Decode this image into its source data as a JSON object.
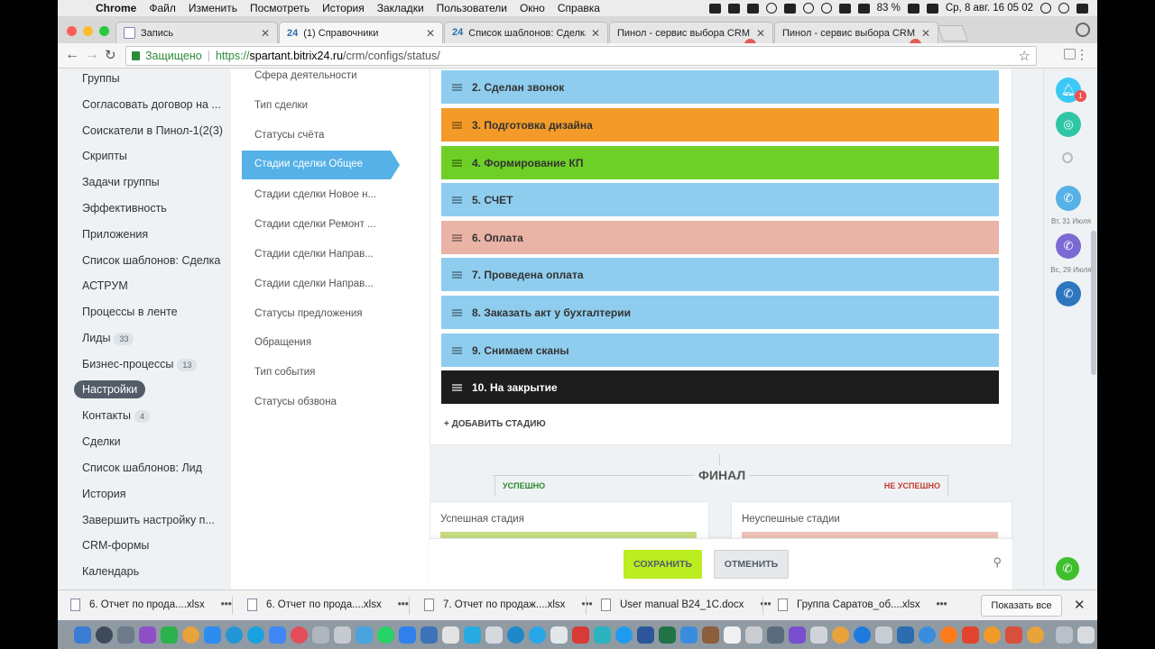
{
  "menubar": {
    "items": [
      "Chrome",
      "Файл",
      "Изменить",
      "Посмотреть",
      "История",
      "Закладки",
      "Пользователи",
      "Окно",
      "Справка"
    ],
    "battery": "83 %",
    "datetime": "Ср, 8 авг.  16 05 02"
  },
  "tabs": [
    {
      "title": "Запись",
      "icon": "doc-icon"
    },
    {
      "title": "(1) Справочники",
      "icon": "bitrix24-icon",
      "prefix": "24"
    },
    {
      "title": "Список шаблонов: Сделка",
      "icon": "bitrix24-icon",
      "prefix": "24"
    },
    {
      "title": "Пинол - сервис выбора CRM",
      "icon": "pinol-icon"
    },
    {
      "title": "Пинол - сервис выбора CRM",
      "icon": "pinol-icon"
    }
  ],
  "address": {
    "secure_label": "Защищено",
    "scheme": "https://",
    "host": "spartant.bitrix24.ru",
    "path": "/crm/configs/status/"
  },
  "leftnav": {
    "items": [
      {
        "label": "Группы"
      },
      {
        "label": "Согласовать договор на ..."
      },
      {
        "label": "Соискатели в Пинол-1(2(3)"
      },
      {
        "label": "Скрипты"
      },
      {
        "label": "Задачи группы"
      },
      {
        "label": "Эффективность"
      },
      {
        "label": "Приложения"
      },
      {
        "label": "Список шаблонов: Сделка"
      },
      {
        "label": "АСТРУМ"
      },
      {
        "label": "Процессы в ленте"
      },
      {
        "label": "Лиды",
        "count": "33"
      },
      {
        "label": "Бизнес-процессы",
        "count": "13"
      },
      {
        "label": "Настройки"
      },
      {
        "label": "Контакты",
        "count": "4"
      },
      {
        "label": "Сделки"
      },
      {
        "label": "Список шаблонов: Лид"
      },
      {
        "label": "История"
      },
      {
        "label": "Завершить настройку п..."
      },
      {
        "label": "CRM-формы"
      },
      {
        "label": "Календарь"
      }
    ]
  },
  "settingsnav": {
    "items": [
      "Сфера деятельности",
      "Тип сделки",
      "Статусы счёта",
      "Стадии сделки Общее",
      "Стадии сделки Новое н...",
      "Стадии сделки Ремонт ...",
      "Стадии сделки Направ...",
      "Стадии сделки Направ...",
      "Статусы предложения",
      "Обращения",
      "Тип события",
      "Статусы обзвона"
    ]
  },
  "stages": [
    {
      "label": "2. Сделан звонок",
      "color": "#8fcdee"
    },
    {
      "label": "3. Подготовка дизайна",
      "color": "#f39a28"
    },
    {
      "label": "4. Формирование КП",
      "color": "#6ed026"
    },
    {
      "label": "5. СЧЕТ",
      "color": "#8fcdee"
    },
    {
      "label": "6. Оплата",
      "color": "#e9b3a6"
    },
    {
      "label": "7. Проведена оплата",
      "color": "#8fcdee"
    },
    {
      "label": "8. Заказать акт у бухгалтерии",
      "color": "#8fcdee"
    },
    {
      "label": "9. Снимаем сканы",
      "color": "#8fcdee"
    },
    {
      "label": "10. На закрытие",
      "color": "#1d1d1d"
    }
  ],
  "add_stage": "+ ДОБАВИТЬ СТАДИЮ",
  "final": {
    "title": "ФИНАЛ",
    "success_label": "УСПЕШНО",
    "fail_label": "НЕ УСПЕШНО",
    "success_box": "Успешная стадия",
    "fail_box": "Неуспешные стадии"
  },
  "buttons": {
    "save": "СОХРАНИТЬ",
    "cancel": "ОТМЕНИТЬ"
  },
  "rightpanel": {
    "notif_count": "1",
    "date1": "Вт, 31 Июля",
    "date2": "Вс, 29 Июля"
  },
  "downloads": {
    "items": [
      "6. Отчет по прода....xlsx",
      "6. Отчет по прода....xlsx",
      "7. Отчет по продаж....xlsx",
      "User manual B24_1C.docx",
      "Группа Саратов_об....xlsx"
    ],
    "show_all": "Показать все"
  }
}
